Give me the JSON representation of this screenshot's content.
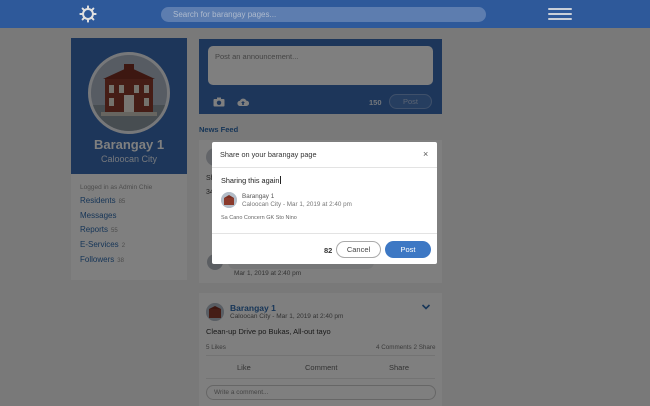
{
  "topbar": {
    "search_placeholder": "Search for barangay pages...",
    "brand_color": "#3566b0"
  },
  "profile": {
    "name": "Barangay 1",
    "city": "Caloocan City",
    "logged_in_text": "Logged in as Admin Chie",
    "links": [
      {
        "label": "Residents",
        "count": "85"
      },
      {
        "label": "Messages",
        "count": ""
      },
      {
        "label": "Reports",
        "count": "55"
      },
      {
        "label": "E-Services",
        "count": "2"
      },
      {
        "label": "Followers",
        "count": "38"
      }
    ]
  },
  "composer": {
    "placeholder": "Post an announcement...",
    "char_count": "150",
    "post_label": "Post"
  },
  "feed": {
    "title": "News Feed",
    "post1": {
      "text_fragment_1": "Sh",
      "text_fragment_2": "34",
      "comment_date": "Mar 1, 2019 at 2:40 pm"
    },
    "post2": {
      "name": "Barangay 1",
      "meta": "Caloocan City - Mar 1, 2019 at 2:40 pm",
      "text": "Clean-up Drive po Bukas, All-out tayo",
      "likes": "5 Likes",
      "comments": "4 Comments",
      "shares": "2 Share",
      "actions": [
        "Like",
        "Comment",
        "Share"
      ],
      "write_comment_placeholder": "Write a comment..."
    }
  },
  "modal": {
    "title": "Share on your barangay page",
    "typed_text": "Sharing this again",
    "shared": {
      "name": "Barangay 1",
      "meta": "Caloocan City - Mar 1, 2019 at 2:40 pm",
      "content": "Sa Cano Concern GK Sto Nino"
    },
    "char_count": "82",
    "cancel_label": "Cancel",
    "post_label": "Post",
    "accent_color": "#3d78c4"
  }
}
